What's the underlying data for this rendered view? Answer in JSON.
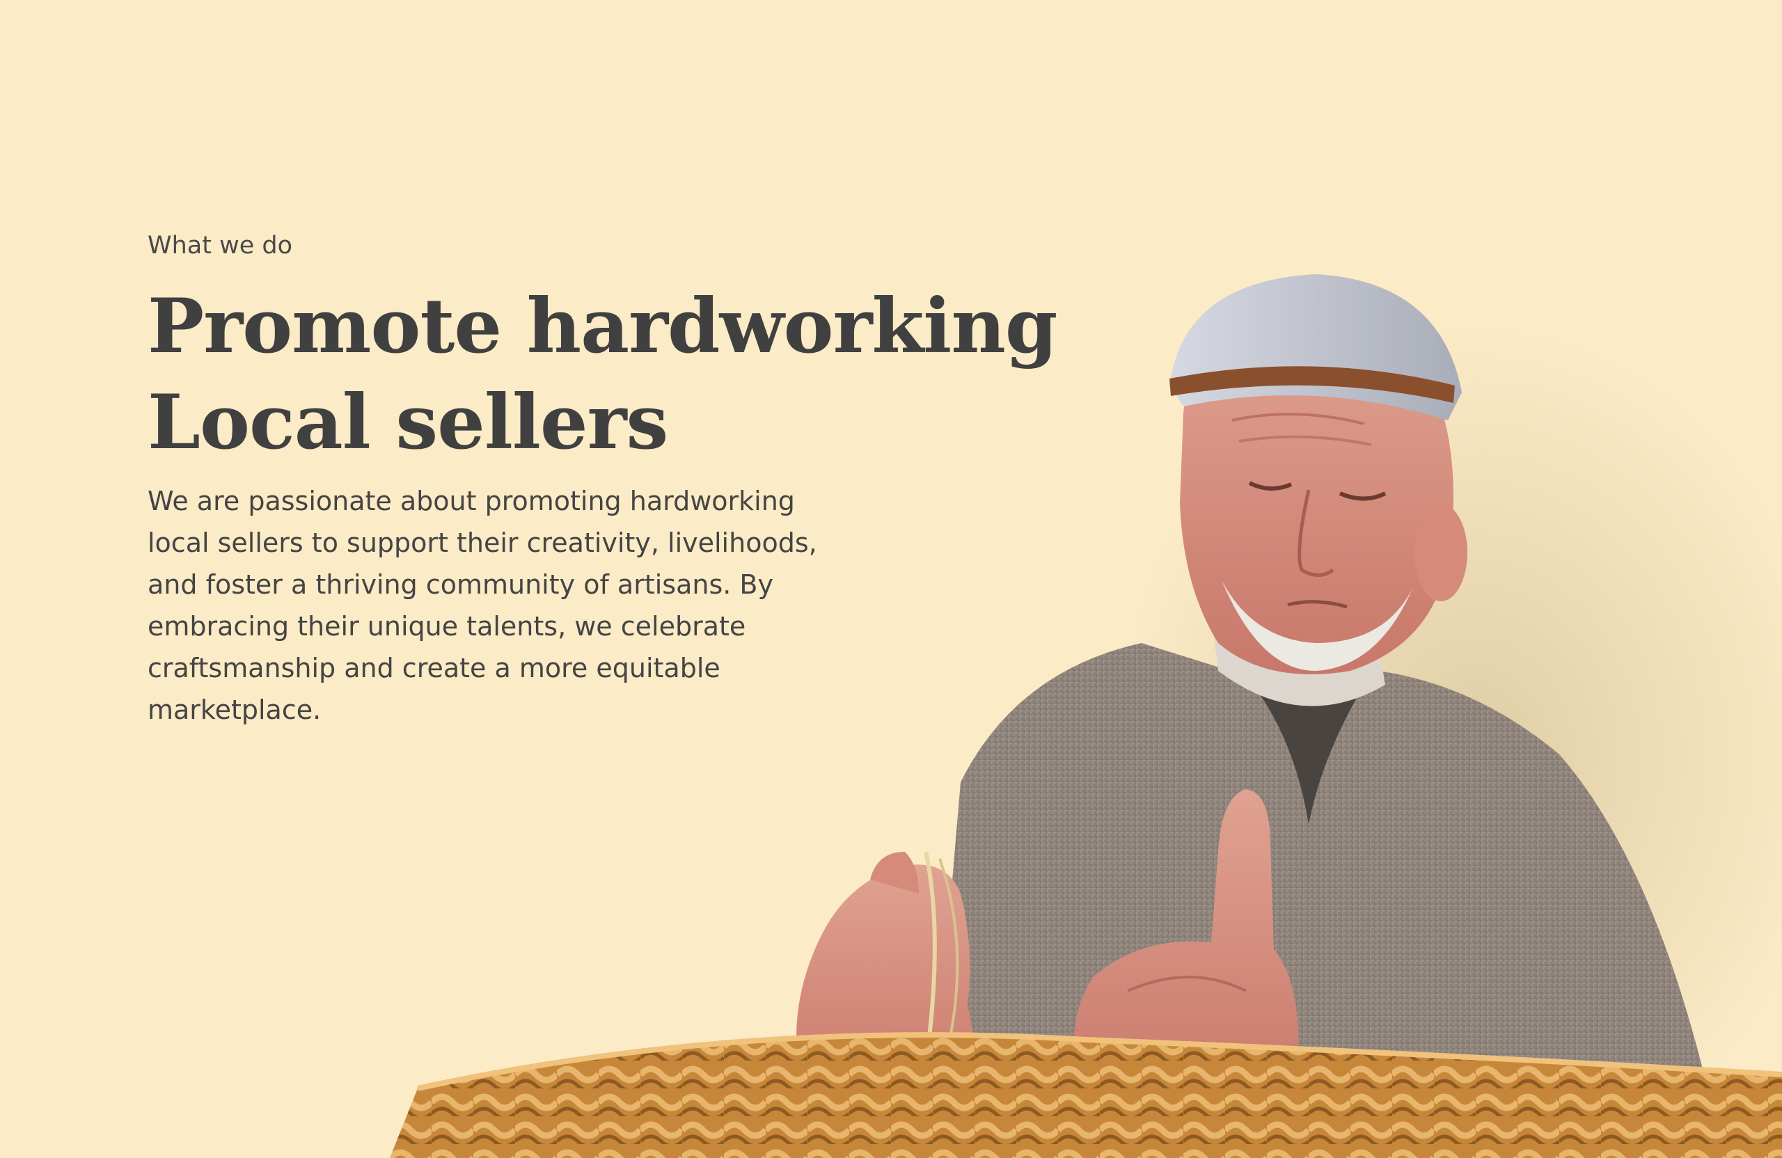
{
  "section": {
    "eyebrow": "What we do",
    "headline_line1": "Promote hardworking",
    "headline_line2": "Local sellers",
    "body": "We are passionate about promoting hardworking local sellers to support their creativity, livelihoods, and foster a thriving community of artisans. By embracing their unique talents, we celebrate craftsmanship and create a more equitable marketplace."
  },
  "illustration": {
    "subject": "elderly artisan weaving a wicker basket",
    "icon": "artisan-photo"
  },
  "colors": {
    "background": "#fbebc6",
    "text": "#414141",
    "skin": "#d98a7c",
    "cap": "#c9ccd3",
    "robe": "#9a8f86",
    "wicker": "#c98a3c"
  }
}
